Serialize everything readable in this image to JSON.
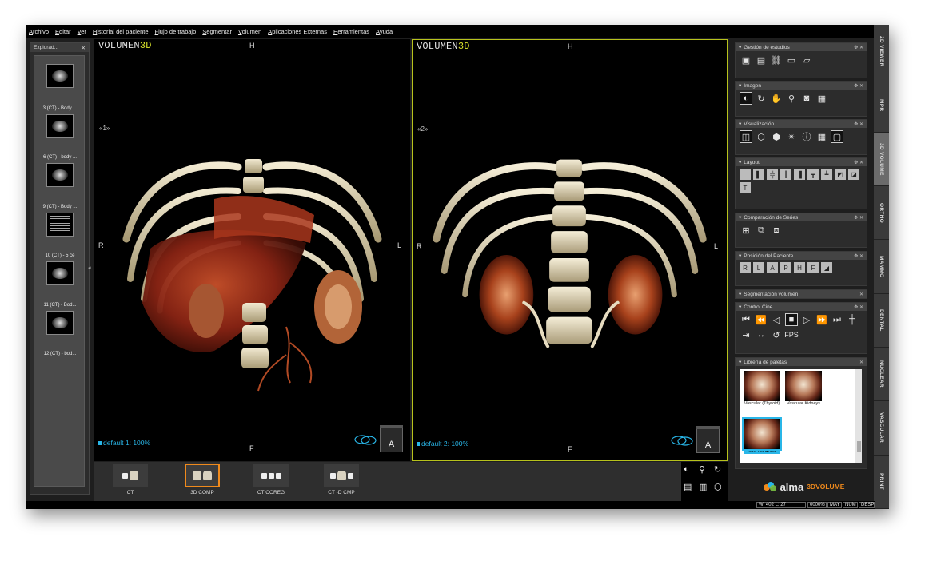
{
  "menu": [
    "Archivo",
    "Editar",
    "Ver",
    "Historial del paciente",
    "Flujo de trabajo",
    "Segmentar",
    "Volumen",
    "Aplicaciones Externas",
    "Herramientas",
    "Ayuda"
  ],
  "right_tabs": [
    {
      "label": "2D VIEWER",
      "active": false
    },
    {
      "label": "MPR",
      "active": false
    },
    {
      "label": "3D VOLUME",
      "active": true
    },
    {
      "label": "ORTHO",
      "active": false
    },
    {
      "label": "MAMMO",
      "active": false
    },
    {
      "label": "DENTAL",
      "active": false
    },
    {
      "label": "NUCLEAR",
      "active": false
    },
    {
      "label": "VASCULAR",
      "active": false
    },
    {
      "label": "PRINT",
      "active": false
    }
  ],
  "explorer": {
    "title": "Explorad...",
    "items": [
      {
        "label": "",
        "kind": "scan"
      },
      {
        "label": "3 (CT) - Body ...",
        "kind": "scan"
      },
      {
        "label": "6 (CT) - body ...",
        "kind": "scan"
      },
      {
        "label": "9 (CT) - Body ...",
        "kind": "doc"
      },
      {
        "label": "10 (CT) -  5  ce",
        "kind": "scan"
      },
      {
        "label": "11 (CT) - Bod...",
        "kind": "scan"
      },
      {
        "label": "12 (CT) - bod...",
        "kind": "none"
      }
    ]
  },
  "viewports": [
    {
      "title_main": "VOLUMEN",
      "title_accent": "3D",
      "orientation": {
        "top": "H",
        "bottom": "F",
        "left": "R",
        "right": "L"
      },
      "index_label": "«1»",
      "status": "default 1: 100%",
      "cube_label": "A",
      "active": false
    },
    {
      "title_main": "VOLUMEN",
      "title_accent": "3D",
      "orientation": {
        "top": "H",
        "bottom": "F",
        "left": "R",
        "right": "L"
      },
      "index_label": "«2»",
      "status": "default 2: 100%",
      "cube_label": "A",
      "active": true
    }
  ],
  "series": [
    {
      "label": "CT",
      "selected": false
    },
    {
      "label": "3D COMP",
      "selected": true
    },
    {
      "label": "CT COREG",
      "selected": false
    },
    {
      "label": "CT -D CMP",
      "selected": false
    }
  ],
  "bottom_tools": [
    "window-level-icon",
    "zoom-icon",
    "rotate-icon",
    "layers-icon",
    "layers-alt-icon",
    "cube-icon"
  ],
  "panels": {
    "gestion": {
      "title": "Gestión de estudios"
    },
    "imagen": {
      "title": "Imagen"
    },
    "visualizacion": {
      "title": "Visualización"
    },
    "layout": {
      "title": "Layout"
    },
    "comparacion": {
      "title": "Comparación de Series"
    },
    "posicion": {
      "title": "Posición del Paciente"
    },
    "segmentacion": {
      "title": "Segmentación volumen"
    },
    "cine": {
      "title": "Control Cine",
      "fps": "FPS"
    },
    "paletas": {
      "title": "Librería de paletas",
      "items": [
        {
          "label": "Vascular (Thyroid)",
          "selected": false
        },
        {
          "label": "Vascular Kidneys",
          "selected": false
        },
        {
          "label": "VascularAorta",
          "selected": true
        }
      ]
    }
  },
  "brand": {
    "name": "alma",
    "product": "3DVOLUME"
  },
  "status_bar": {
    "wl": "W: 402 L: 27",
    "zoom": "0000%",
    "caps": "MAY",
    "num": "NUM",
    "scroll": "DESP"
  },
  "colors": {
    "accent_yellow": "#d8e02a",
    "status_cyan": "#29b6e8",
    "selected_orange": "#f08a1c"
  }
}
